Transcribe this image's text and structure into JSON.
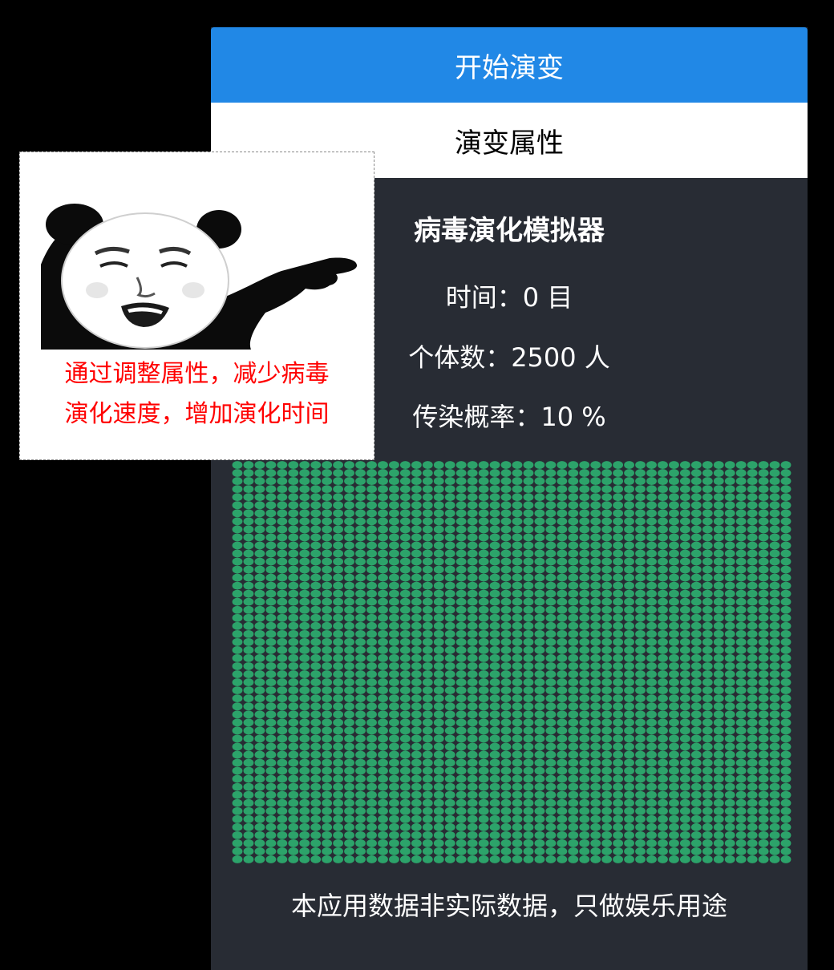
{
  "buttons": {
    "start": "开始演变",
    "properties": "演变属性"
  },
  "simulator": {
    "title": "病毒演化模拟器",
    "time_line": "时间：0 目",
    "count_line": "个体数：2500 人",
    "probability_line": "传染概率：10 %"
  },
  "grid": {
    "rows": 50,
    "cols": 50,
    "healthy_color": "#2ca36a",
    "infected_count": 0
  },
  "footer": {
    "disclaimer": "本应用数据非实际数据，只做娱乐用途"
  },
  "popup": {
    "image": "panda-meme-pointing",
    "line1": "通过调整属性，减少病毒",
    "line2": "演化速度，增加演化时间",
    "text_color": "#ff0000"
  },
  "colors": {
    "page_bg": "#000000",
    "panel_bg": "#282c34",
    "accent": "#2188e6"
  }
}
